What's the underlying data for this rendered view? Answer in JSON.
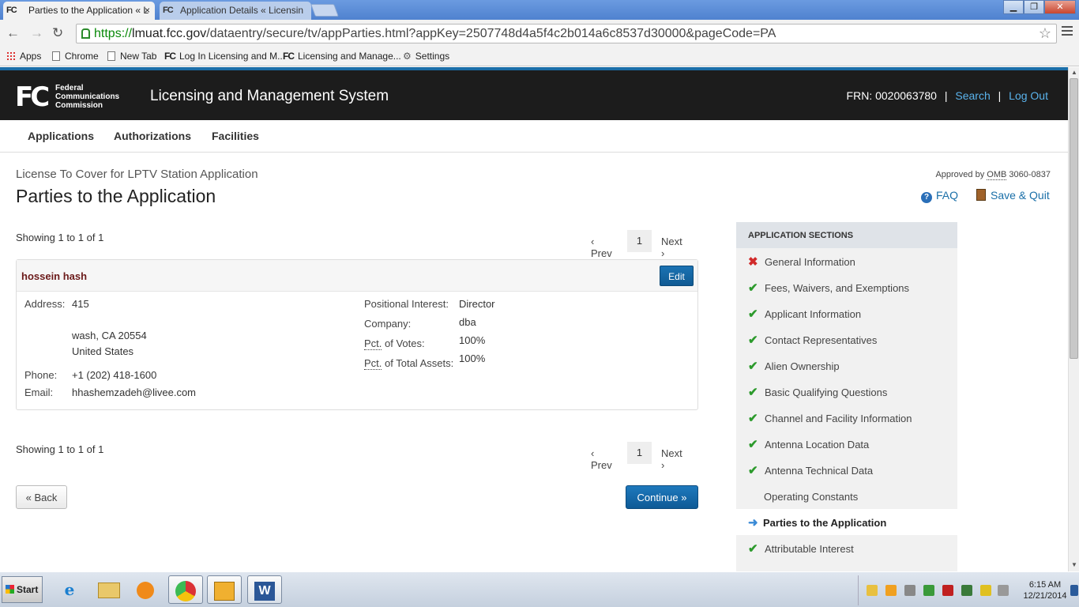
{
  "browser": {
    "tabs": [
      {
        "favicon": "FC",
        "label": "Parties to the Application « L",
        "close": "×"
      },
      {
        "favicon": "FC",
        "label": "Application Details « Licensin"
      }
    ],
    "window_controls": {
      "minimize": "▁",
      "restore": "❐",
      "close": "✕"
    },
    "url_scheme": "https://",
    "url_host": "lmuat.fcc.gov",
    "url_path": "/dataentry/secure/tv/appParties.html?appKey=2507748d4a5f4c2b014a6c8537d30000&pageCode=PA",
    "bookmarks": [
      {
        "label": "Apps",
        "icon": "apps-grid-icon"
      },
      {
        "label": "Chrome",
        "icon": "page-icon"
      },
      {
        "label": "New Tab",
        "icon": "page-icon"
      },
      {
        "label": "Log In Licensing and M...",
        "icon": "fcc-favicon"
      },
      {
        "label": "Licensing and Manage...",
        "icon": "fcc-favicon"
      },
      {
        "label": "Settings",
        "icon": "gear-icon"
      }
    ]
  },
  "header": {
    "logo": "FC",
    "agency_line1": "Federal",
    "agency_line2": "Communications",
    "agency_line3": "Commission",
    "system_title": "Licensing and Management System",
    "frn_text": "FRN: 0020063780",
    "sep": "|",
    "search": "Search",
    "logout": "Log Out"
  },
  "nav": [
    "Applications",
    "Authorizations",
    "Facilities"
  ],
  "page": {
    "subtitle": "License To Cover for LPTV Station Application",
    "title": "Parties to the Application",
    "omb_prefix": "Approved by",
    "omb_abbr": "OMB",
    "omb_number": "3060-0837",
    "faq": "FAQ",
    "save_quit": "Save & Quit"
  },
  "pagination": {
    "showing": "Showing 1 to 1 of 1",
    "prev": "‹ Prev",
    "page": "1",
    "next": "Next ›"
  },
  "party": {
    "name": "hossein hash",
    "edit": "Edit",
    "address_label": "Address:",
    "address_line1": "415",
    "address_line2": "wash, CA 20554",
    "address_line3": "United States",
    "phone_label": "Phone:",
    "phone": "+1 (202) 418-1600",
    "email_label": "Email:",
    "email": "hhashemzadeh@livee.com",
    "positional_label": "Positional Interest:",
    "positional": "Director",
    "company_label": "Company:",
    "company": "dba",
    "pct_abbr": "Pct.",
    "votes_label": " of Votes:",
    "votes": "100%",
    "assets_label": " of Total Assets:",
    "assets": "100%"
  },
  "buttons": {
    "back": "« Back",
    "continue": "Continue »"
  },
  "sections": {
    "heading": "APPLICATION SECTIONS",
    "items": [
      {
        "label": "General Information",
        "status": "error"
      },
      {
        "label": "Fees, Waivers, and Exemptions",
        "status": "complete"
      },
      {
        "label": "Applicant Information",
        "status": "complete"
      },
      {
        "label": "Contact Representatives",
        "status": "complete"
      },
      {
        "label": "Alien Ownership",
        "status": "complete"
      },
      {
        "label": "Basic Qualifying Questions",
        "status": "complete"
      },
      {
        "label": "Channel and Facility Information",
        "status": "complete"
      },
      {
        "label": "Antenna Location Data",
        "status": "complete"
      },
      {
        "label": "Antenna Technical Data",
        "status": "complete"
      },
      {
        "label": "Operating Constants",
        "status": "none"
      },
      {
        "label": "Parties to the Application",
        "status": "current"
      },
      {
        "label": "Attributable Interest",
        "status": "complete"
      }
    ]
  },
  "taskbar": {
    "start": "Start",
    "time": "6:15 AM",
    "date": "12/21/2014"
  },
  "colors": {
    "header_bg": "#1c1c1c",
    "link_blue": "#5ab3ec",
    "button_blue": "#1b73b3",
    "party_name": "#6b1a1a",
    "check_green": "#2c9a2c",
    "error_red": "#d12a2a"
  }
}
